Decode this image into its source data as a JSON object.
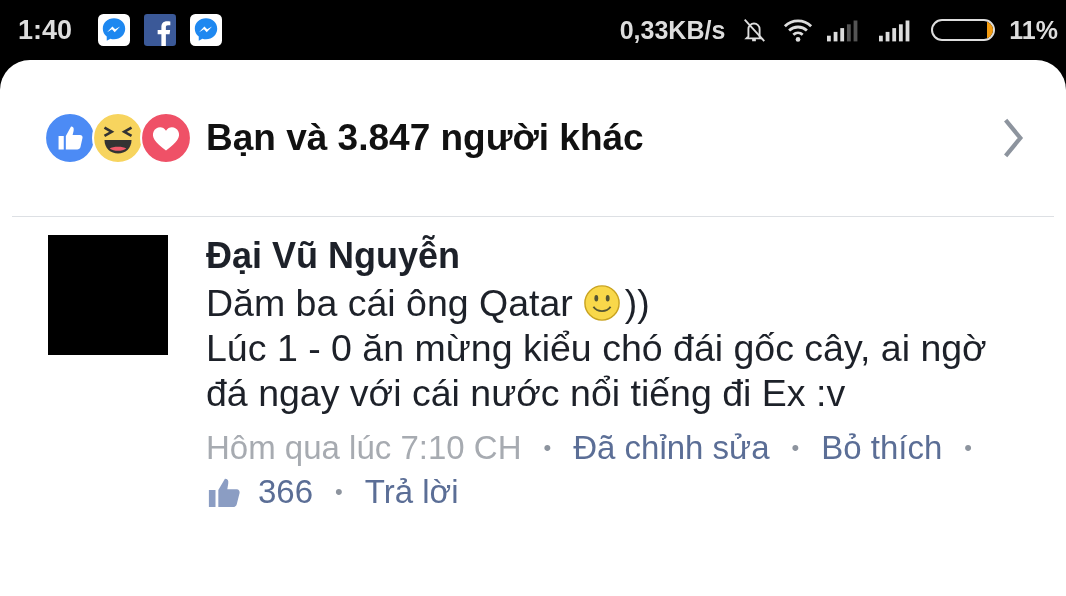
{
  "status_bar": {
    "time": "1:40",
    "apps": [
      {
        "kind": "messenger"
      },
      {
        "kind": "facebook"
      },
      {
        "kind": "messenger"
      }
    ],
    "speed": "0,33KB/s",
    "battery": {
      "level": 0.11,
      "percent": "11%"
    }
  },
  "reactions": {
    "kinds": [
      {
        "kind": "like"
      },
      {
        "kind": "haha"
      },
      {
        "kind": "love"
      }
    ],
    "summary": "Bạn và 3.847 người khác"
  },
  "comment": {
    "author": "Đại Vũ Nguyễn",
    "lines": [
      {
        "text": "Dăm ba cái ông Qatar",
        "emoji": {
          "kind": "smile"
        },
        "after": "))"
      },
      {
        "text": "Lúc 1 - 0 ăn mừng kiểu chó đái gốc cây, ai ngờ đá ngay với cái nước nổi tiếng đi Ex :v"
      }
    ],
    "meta": [
      {
        "kind": "time",
        "text": "Hôm qua lúc 7:10 CH"
      },
      {
        "kind": "sep",
        "text": "•"
      },
      {
        "kind": "link",
        "text": "Đã chỉnh sửa"
      },
      {
        "kind": "sep",
        "text": "•"
      },
      {
        "kind": "link",
        "text": "Bỏ thích"
      },
      {
        "kind": "sep",
        "text": "•"
      },
      {
        "kind": "likes",
        "text": "366"
      },
      {
        "kind": "sep",
        "text": "•"
      },
      {
        "kind": "link",
        "text": "Trả lời"
      }
    ]
  }
}
